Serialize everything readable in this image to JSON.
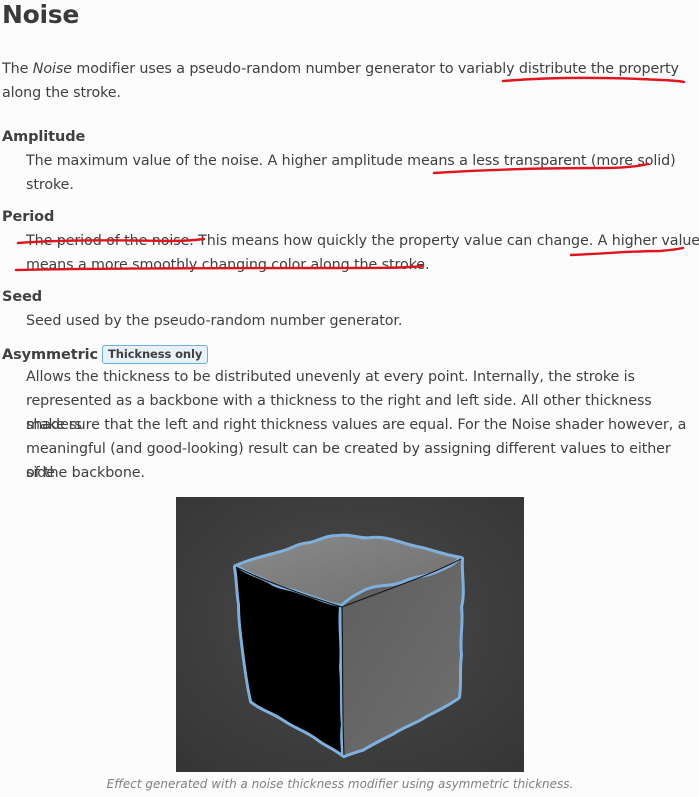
{
  "title": "Noise",
  "intro": {
    "pre": "The ",
    "em": "Noise",
    "line1": " modifier uses a pseudo-random number generator to variably distribute the property",
    "line2": "along the stroke."
  },
  "amplitude": {
    "term": "Amplitude",
    "line1": "The maximum value of the noise. A higher amplitude means a less transparent (more solid)",
    "line2": "stroke."
  },
  "period": {
    "term": "Period",
    "line1": "The period of the noise. This means how quickly the property value can change. A higher value",
    "line2": "means a more smoothly changing color along the stroke."
  },
  "seed": {
    "term": "Seed",
    "line1": "Seed used by the pseudo-random number generator."
  },
  "asymmetric": {
    "term": "Asymmetric",
    "badge": "Thickness only",
    "line1": "Allows the thickness to be distributed unevenly at every point. Internally, the stroke is",
    "line2": "represented as a backbone with a thickness to the right and left side. All other thickness shaders",
    "line3": "make sure that the left and right thickness values are equal. For the Noise shader however, a",
    "line4": "meaningful (and good-looking) result can be created by assigning different values to either side",
    "line5": "of the backbone."
  },
  "figure": {
    "caption": "Effect generated with a noise thickness modifier using asymmetric thickness."
  },
  "colors": {
    "annotation": "#e0141e",
    "stroke": "#7fb0dd"
  }
}
